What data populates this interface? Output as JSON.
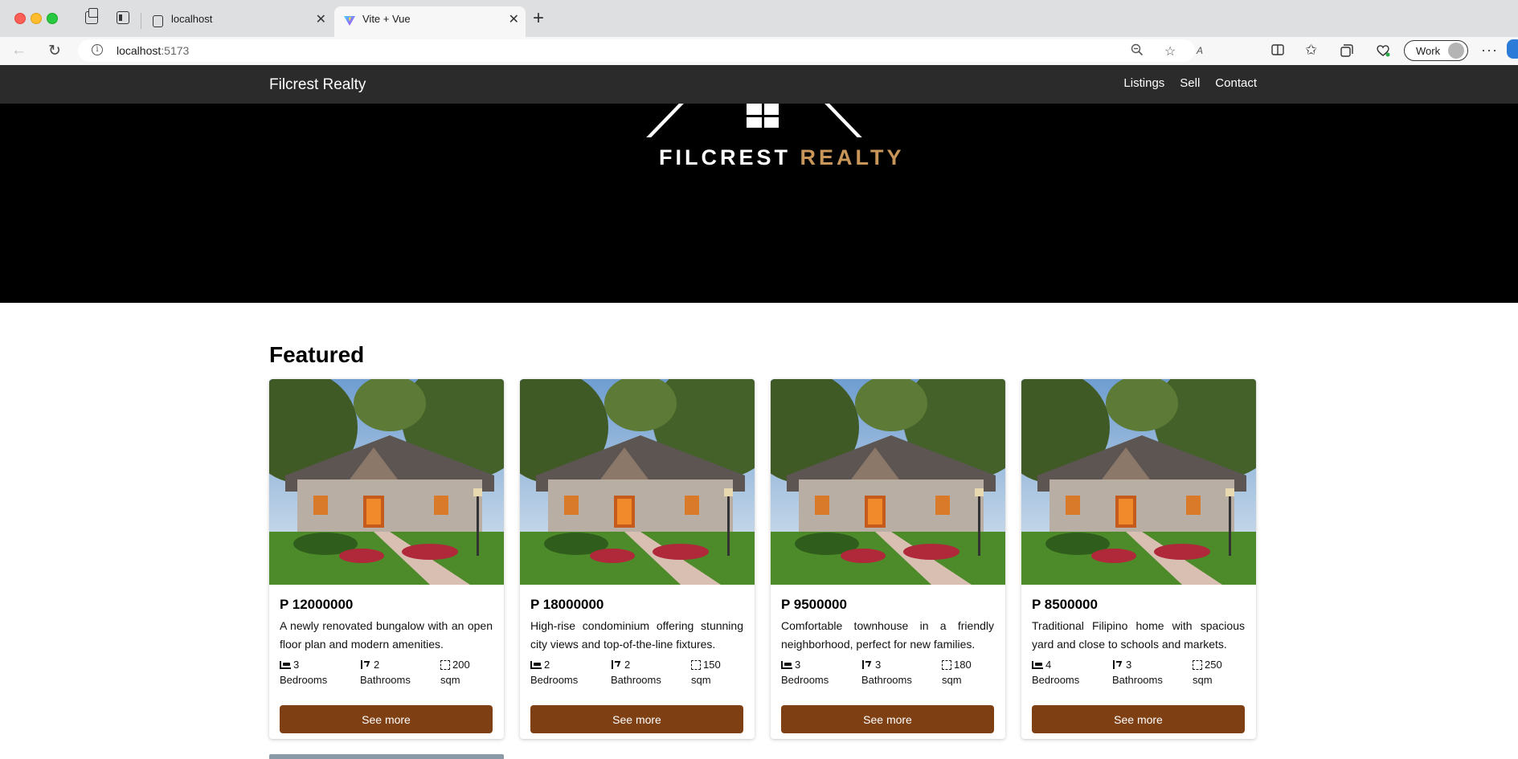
{
  "browser": {
    "tabs": [
      {
        "label": "localhost",
        "active": false
      },
      {
        "label": "Vite + Vue",
        "active": true
      }
    ],
    "url_host": "localhost",
    "url_port": ":5173",
    "profile_label": "Work",
    "icons": [
      "back-icon",
      "reload-icon",
      "info-icon",
      "zoom-out-icon",
      "read-aloud-icon",
      "favorite-star-icon",
      "split-screen-icon",
      "favorites-icon",
      "collections-icon",
      "browser-essentials-icon",
      "more-icon",
      "copilot-icon"
    ]
  },
  "site": {
    "brand": "Filcrest Realty",
    "nav": [
      "Listings",
      "Sell",
      "Contact"
    ],
    "logo": {
      "word1": "FILCREST",
      "word2": "REALTY"
    },
    "colors": {
      "nav_bg": "#2b2b2b",
      "hero_bg": "#000000",
      "accent_gold": "#c9965a",
      "button_brown": "#7e3f13"
    }
  },
  "featured": {
    "title": "Featured",
    "listings": [
      {
        "price": "P 12000000",
        "description": "A newly renovated bungalow with an open floor plan and modern amenities.",
        "bedrooms": "3",
        "bathrooms": "2",
        "area": "200",
        "bed_label": "Bedrooms",
        "bath_label": "Bathrooms",
        "area_label": "sqm",
        "button": "See more"
      },
      {
        "price": "P 18000000",
        "description": "High-rise condominium offering stunning city views and top-of-the-line fixtures.",
        "bedrooms": "2",
        "bathrooms": "2",
        "area": "150",
        "bed_label": "Bedrooms",
        "bath_label": "Bathrooms",
        "area_label": "sqm",
        "button": "See more"
      },
      {
        "price": "P 9500000",
        "description": "Comfortable townhouse in a friendly neighborhood, perfect for new families.",
        "bedrooms": "3",
        "bathrooms": "3",
        "area": "180",
        "bed_label": "Bedrooms",
        "bath_label": "Bathrooms",
        "area_label": "sqm",
        "button": "See more"
      },
      {
        "price": "P 8500000",
        "description": "Traditional Filipino home with spacious yard and close to schools and markets.",
        "bedrooms": "4",
        "bathrooms": "3",
        "area": "250",
        "bed_label": "Bedrooms",
        "bath_label": "Bathrooms",
        "area_label": "sqm",
        "button": "See more"
      }
    ]
  }
}
